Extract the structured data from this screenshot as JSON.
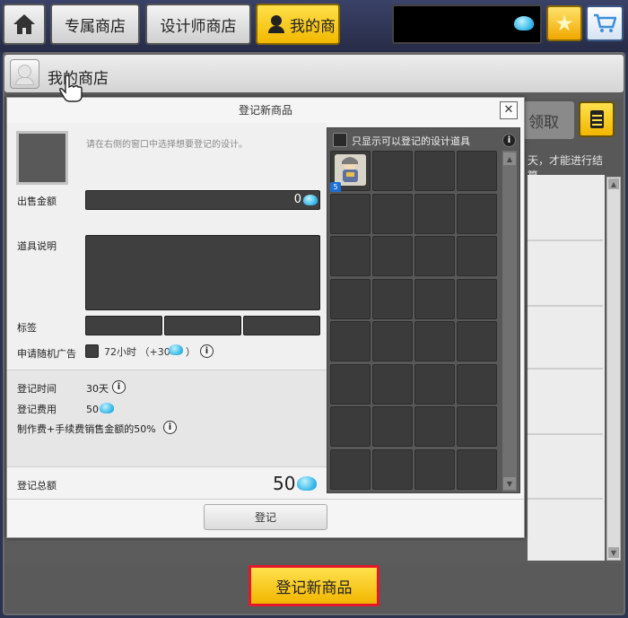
{
  "tabs": {
    "home_icon": "home-icon",
    "exclusive": "专属商店",
    "designer": "设计师商店",
    "mine": "我的商"
  },
  "toolbar": {
    "currency_icon": "slime-currency-icon",
    "favorite_icon": "star-icon",
    "cart_icon": "cart-icon"
  },
  "panel": {
    "title": "我的商店",
    "receive_button": "领取",
    "bg_note": "天，才能进行结算。",
    "register_new_button": "登记新商品"
  },
  "dialog": {
    "title": "登记新商品",
    "close": "✕",
    "hint": "请在右侧的窗口中选择想要登记的设计。",
    "price_label": "出售金额",
    "price_value": "0",
    "description_label": "道具说明",
    "tag_label": "标签",
    "ad_label": "申请随机广告",
    "ad_duration": "72小时",
    "ad_cost": "（+30",
    "ad_cost_close": "）",
    "info": "i",
    "register_time_label": "登记时间",
    "register_time_value": "30天",
    "register_fee_label": "登记费用",
    "register_fee_value": "50",
    "fee_note": "制作费+手续费销售金额的50%",
    "total_label": "登记总额",
    "total_value": "50",
    "register_button": "登记",
    "inventory_filter_label": "只显示可以登记的设计道具",
    "item_badge": "5",
    "colors": {
      "accent_yellow": "#f2b600",
      "highlight_red": "#e3192b",
      "currency_blue": "#2fb3e6"
    }
  }
}
